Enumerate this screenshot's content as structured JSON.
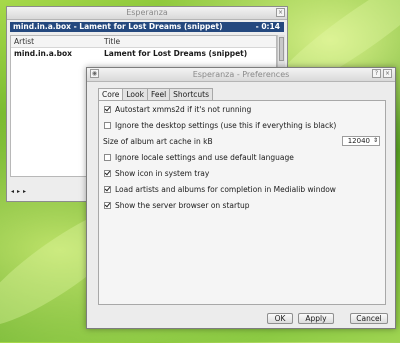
{
  "desktop": {
    "accent": "#24487e",
    "wallpaper": "green-leaf"
  },
  "player": {
    "title": "Esperanza",
    "now_playing": "mind.in.a.box - Lament for Lost Dreams (snippet)",
    "time": "- 0:14",
    "columns": [
      "Artist",
      "Title"
    ],
    "rows": [
      {
        "artist": "mind.in.a.box",
        "title": "Lament for Lost Dreams (snippet)"
      }
    ],
    "controls": [
      "prev-icon",
      "play-icon",
      "next-icon"
    ],
    "control_glyphs": "◂ ▸ ▸"
  },
  "prefs": {
    "title": "Esperanza - Preferences",
    "tabs": [
      "Core",
      "Look",
      "Feel",
      "Shortcuts"
    ],
    "active_tab": "Core",
    "options": [
      {
        "label": "Autostart xmms2d if it's not running",
        "checked": true
      },
      {
        "label": "Ignore the desktop settings (use this if everything is black)",
        "checked": false
      },
      {
        "label": "Size of album art cache in kB",
        "value": "12040"
      },
      {
        "label": "Ignore locale settings and use default language",
        "checked": false
      },
      {
        "label": "Show icon in system tray",
        "checked": true
      },
      {
        "label": "Load artists and albums for completion in Medialib window",
        "checked": true
      },
      {
        "label": "Show the server browser on startup",
        "checked": true
      }
    ],
    "buttons": {
      "ok": "OK",
      "apply": "Apply",
      "cancel": "Cancel"
    }
  }
}
